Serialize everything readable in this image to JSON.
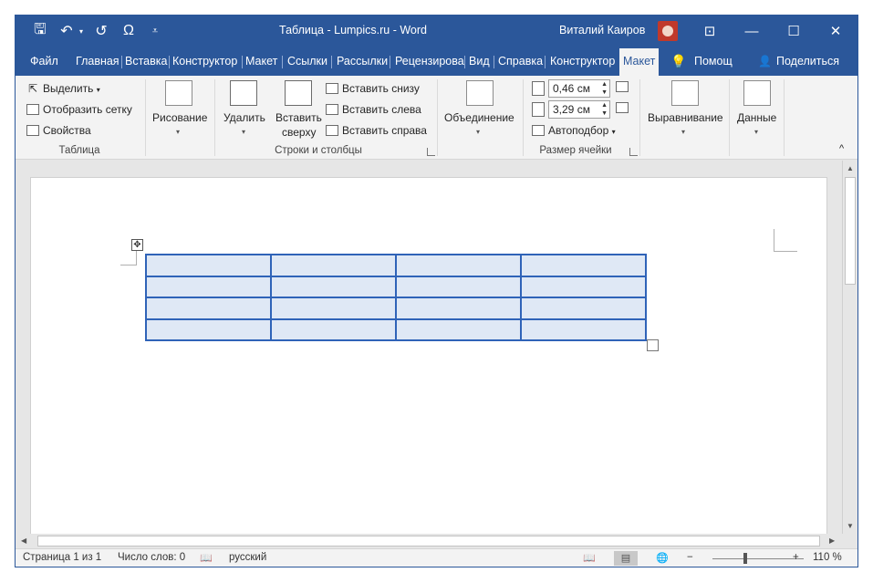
{
  "titlebar": {
    "title": "Таблица - Lumpics.ru  -  Word",
    "user": "Виталий Каиров",
    "quick_access": [
      "save-icon",
      "undo-icon",
      "redo-icon",
      "omega-icon",
      "customize-icon"
    ],
    "window_buttons": [
      "ribbon-display-icon",
      "minimize-icon",
      "maximize-icon",
      "close-icon"
    ],
    "qa_glyphs": {
      "save": "🖫",
      "undo": "↶",
      "undo_caret": "▾",
      "redo": "↺",
      "omega": "Ω",
      "customize": "⩡"
    },
    "win_glyphs": {
      "ribbon": "⊡",
      "minimize": "—",
      "maximize": "☐",
      "close": "✕"
    }
  },
  "tabs": {
    "items": [
      "Файл",
      "Главная",
      "Вставка",
      "Конструктор",
      "Макет",
      "Ссылки",
      "Рассылки",
      "Рецензирова",
      "Вид",
      "Справка",
      "Конструктор",
      "Макет"
    ],
    "active": "Макет",
    "help_search": "Помощ",
    "share": "Поделиться",
    "help_icon": "💡",
    "share_icon": "👤"
  },
  "ribbon": {
    "table_group": {
      "select": "Выделить",
      "show_grid": "Отобразить сетку",
      "properties": "Свойства",
      "label": "Таблица"
    },
    "draw_group": {
      "draw": "Рисование"
    },
    "rows_cols_group": {
      "delete": "Удалить",
      "insert_above_line1": "Вставить",
      "insert_above_line2": "сверху",
      "insert_below": "Вставить снизу",
      "insert_left": "Вставить слева",
      "insert_right": "Вставить справа",
      "label": "Строки и столбцы"
    },
    "merge_group": {
      "merge": "Объединение"
    },
    "cell_size_group": {
      "height": "0,46 см",
      "width": "3,29 см",
      "autofit": "Автоподбор",
      "label": "Размер ячейки"
    },
    "alignment": "Выравнивание",
    "data": "Данные",
    "collapse_icon": "^",
    "dropdown_caret": "▾",
    "spin_up": "▲",
    "spin_down": "▼"
  },
  "document": {
    "table_rows": 4,
    "table_cols": 4,
    "table_border_color": "#2f63b8",
    "table_fill_color": "#dfe8f5",
    "move_handle_glyph": "✥"
  },
  "scrollbars": {
    "up": "▲",
    "down": "▼",
    "left": "◀",
    "right": "▶"
  },
  "status": {
    "page": "Страница 1 из 1",
    "words": "Число слов: 0",
    "language": "русский",
    "zoom": "110 %",
    "zoom_minus": "−",
    "zoom_plus": "+",
    "proofing_glyph": "📖",
    "view_glyphs": {
      "read": "📖",
      "print": "▤",
      "web": "🌐"
    }
  },
  "colors": {
    "brand": "#2b579a",
    "ribbon_bg": "#f3f3f3",
    "canvas_bg": "#e6e6e6"
  }
}
